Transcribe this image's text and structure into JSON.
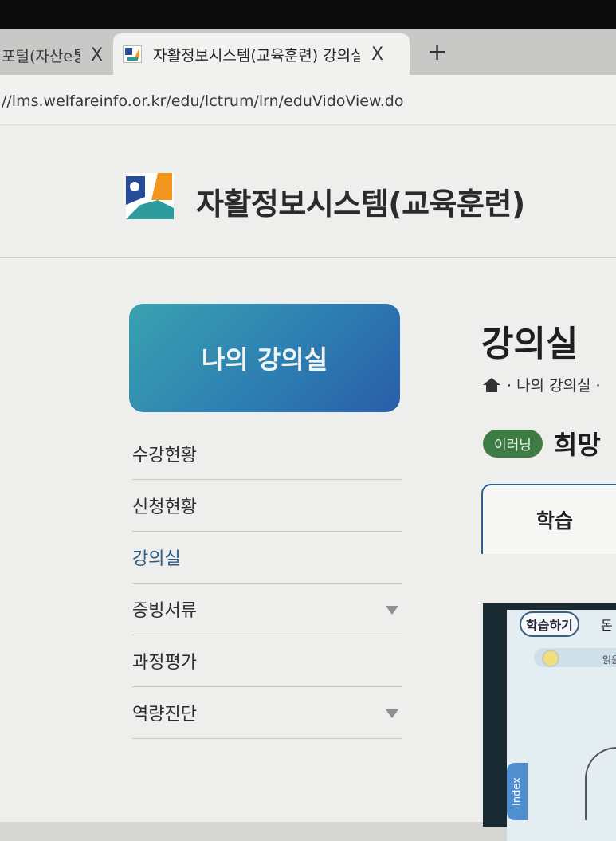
{
  "browser": {
    "tabs": [
      {
        "title": "포털(자산e통"
      },
      {
        "title": "자활정보시스템(교육훈련) 강의실"
      }
    ],
    "close_glyph": "X",
    "new_tab_glyph": "+",
    "url": "//lms.welfareinfo.or.kr/edu/lctrum/lrn/eduVidoView.do"
  },
  "site": {
    "title": "자활정보시스템(교육훈련)"
  },
  "sidebar": {
    "heading": "나의 강의실",
    "items": [
      {
        "label": "수강현황",
        "active": false,
        "has_submenu": false
      },
      {
        "label": "신청현황",
        "active": false,
        "has_submenu": false
      },
      {
        "label": "강의실",
        "active": true,
        "has_submenu": false
      },
      {
        "label": "증빙서류",
        "active": false,
        "has_submenu": true
      },
      {
        "label": "과정평가",
        "active": false,
        "has_submenu": false
      },
      {
        "label": "역량진단",
        "active": false,
        "has_submenu": true
      }
    ]
  },
  "main": {
    "title": "강의실",
    "breadcrumb": "· 나의 강의실 ·",
    "course_badge": "이러닝",
    "course_title": "희망",
    "tab_label": "학습"
  },
  "player": {
    "study_button": "학습하기",
    "next_button": "돈",
    "hint_text": "읽을",
    "index_label": "Index"
  },
  "colors": {
    "accent": "#2d5f93",
    "badge_green": "#3d7d43",
    "active_menu": "#2d5b86"
  }
}
